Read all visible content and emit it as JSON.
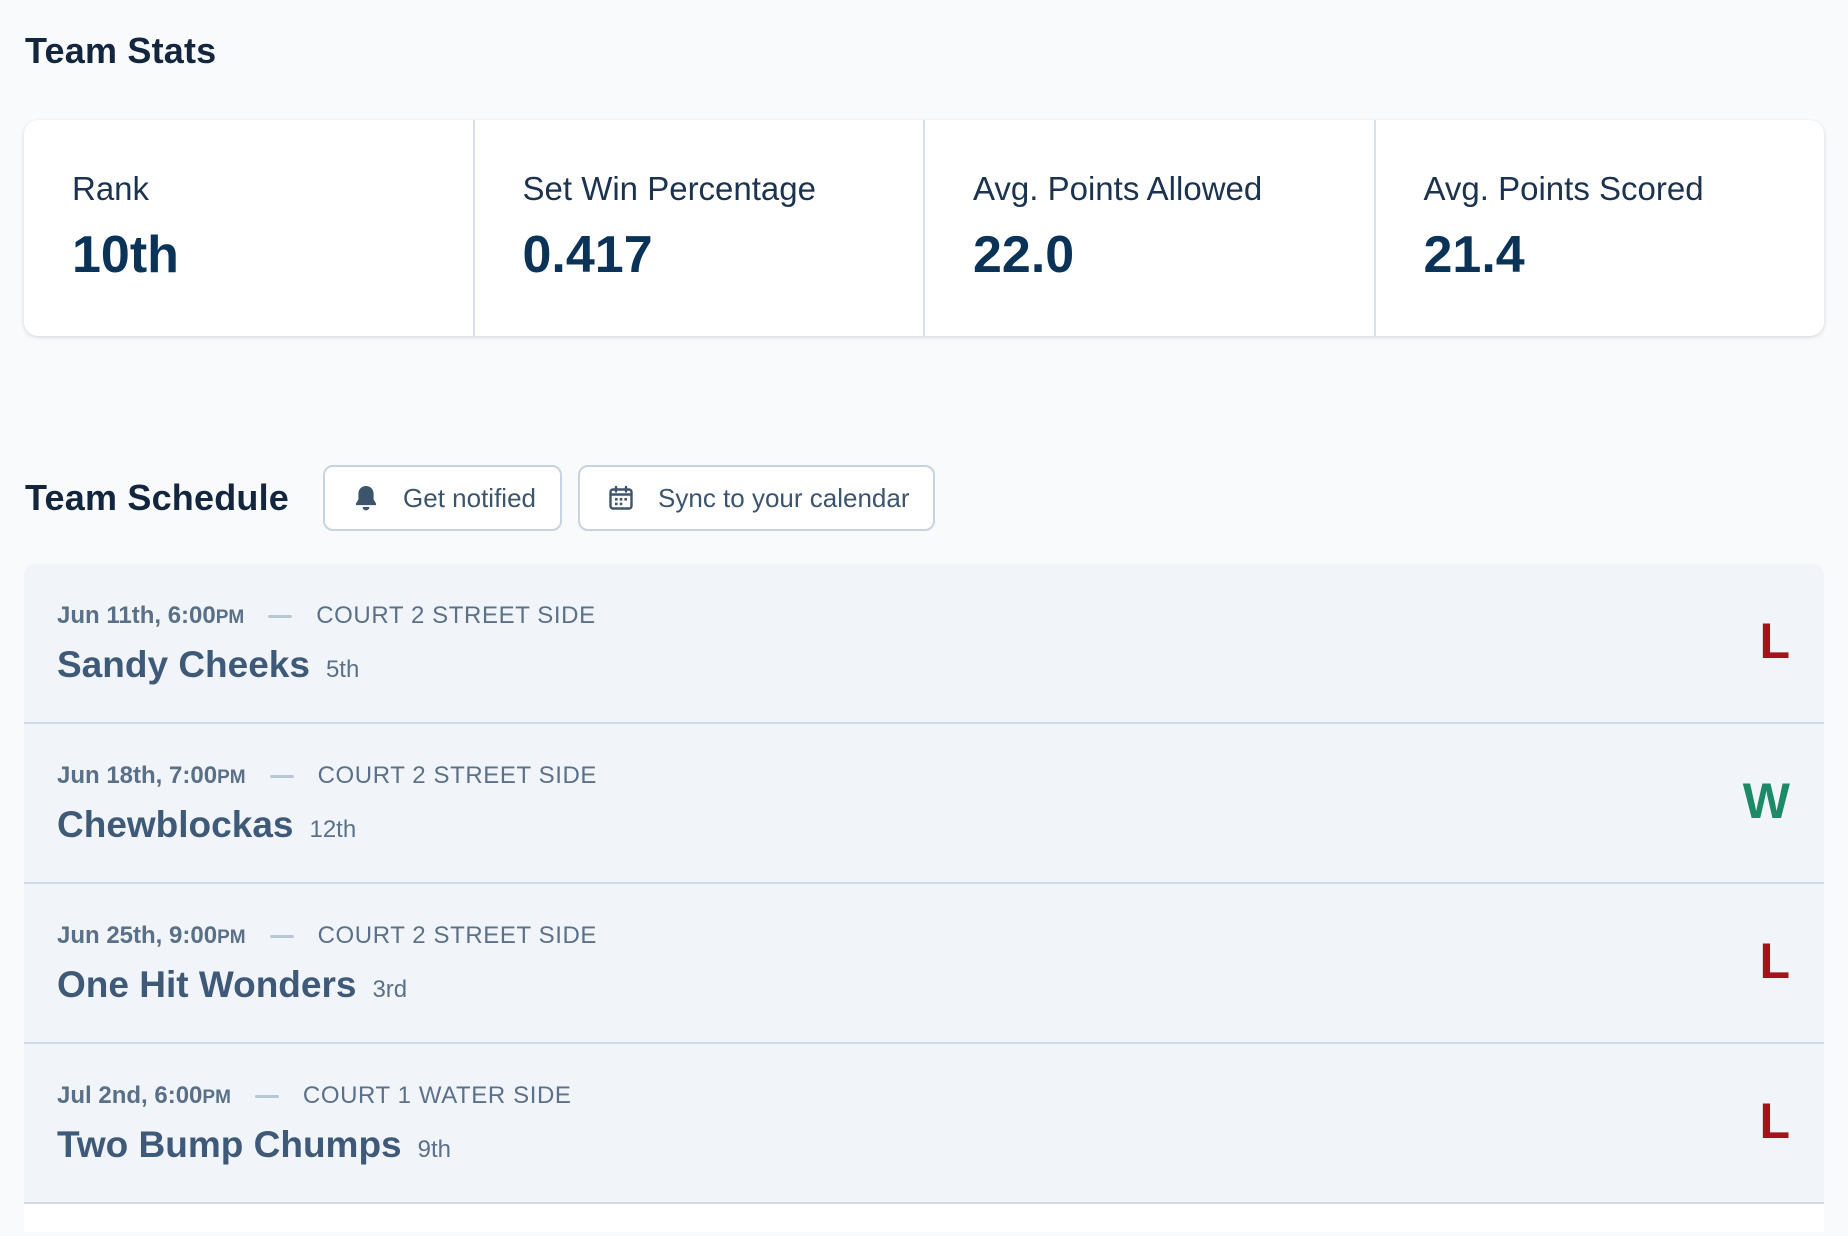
{
  "stats": {
    "title": "Team Stats",
    "items": [
      {
        "label": "Rank",
        "value": "10th"
      },
      {
        "label": "Set Win Percentage",
        "value": "0.417"
      },
      {
        "label": "Avg. Points Allowed",
        "value": "22.0"
      },
      {
        "label": "Avg. Points Scored",
        "value": "21.4"
      }
    ]
  },
  "schedule": {
    "title": "Team Schedule",
    "notify_label": "Get notified",
    "sync_label": "Sync to your calendar",
    "icons": {
      "notify": "bell-icon",
      "sync": "calendar-icon"
    },
    "games": [
      {
        "date": "Jun 11th, 6:00",
        "suffix": "PM",
        "court": "COURT 2 STREET SIDE",
        "opponent": "Sandy Cheeks",
        "rank": "5th",
        "result": "L"
      },
      {
        "date": "Jun 18th, 7:00",
        "suffix": "PM",
        "court": "COURT 2 STREET SIDE",
        "opponent": "Chewblockas",
        "rank": "12th",
        "result": "W"
      },
      {
        "date": "Jun 25th, 9:00",
        "suffix": "PM",
        "court": "COURT 2 STREET SIDE",
        "opponent": "One Hit Wonders",
        "rank": "3rd",
        "result": "L"
      },
      {
        "date": "Jul 2nd, 6:00",
        "suffix": "PM",
        "court": "COURT 1 WATER SIDE",
        "opponent": "Two Bump Chumps",
        "rank": "9th",
        "result": "L"
      }
    ]
  },
  "colors": {
    "loss": "#a1141c",
    "win": "#1d8a66",
    "value": "#0b3358"
  }
}
